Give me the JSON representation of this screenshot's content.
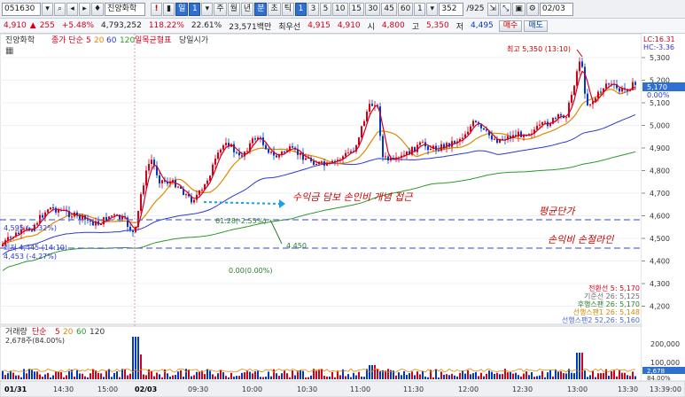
{
  "toolbar": {
    "code": "051630",
    "name": "진양화학",
    "btn_exclaim": "!",
    "btn_day": "일",
    "btn_day_num": "1",
    "periods": [
      "주",
      "월",
      "년",
      "분",
      "초",
      "틱"
    ],
    "minutes": [
      "1",
      "3",
      "5",
      "10",
      "15",
      "30",
      "45",
      "60",
      "1"
    ],
    "page": "352",
    "page_total": "/925",
    "date": "02/03"
  },
  "quote": {
    "price": "4,910",
    "change_arrow": "▲",
    "change": "255",
    "change_pct": "+5.48%",
    "volume": "4,793,252",
    "vol_ratio": "118.22%",
    "turnover": "22.61%",
    "amount": "23,571백만",
    "bid_label": "최우선",
    "bid1": "4,915",
    "bid2": "4,910",
    "open_label": "시",
    "open": "4,800",
    "high_label": "고",
    "high": "5,350",
    "low_label": "저",
    "low": "4,495",
    "buy_label": "매수",
    "sell_label": "매도"
  },
  "legend": {
    "name": "진양화학",
    "ma_label": "종가 단순",
    "ma_periods": [
      "5",
      "20",
      "60",
      "120"
    ],
    "ichimoku": "일목균형표",
    "daytime": "당일시가"
  },
  "annotations": {
    "high_marker": "최고 5,350 (13:10)",
    "strategy": "수익금 담보 손인비 개념 접근",
    "avg_cost": "평균단가",
    "stoploss": "손익비 손절라인",
    "avg_level": "61.28(-2.55%)",
    "stop_level": "4,450",
    "zero_level": "0.00(0.00%)",
    "left_label1": "4,595 (-1.32%)",
    "left_label2": "최저 4,445 (14:10)",
    "left_label3": "4,453 (-4.27%)",
    "lc": "LC:16.31",
    "hc": "HC:-3.36"
  },
  "ichimoku_labels": [
    {
      "text": "전환선 5: 5,170",
      "color": "#d4001a"
    },
    {
      "text": "기준선 26: 5,125",
      "color": "#6b6b6b"
    },
    {
      "text": "후행스팬 26: 5,170",
      "color": "#2a7d2a"
    },
    {
      "text": "선행스팬1 26: 5,148",
      "color": "#d48a00"
    },
    {
      "text": "선행스팬2 52,26: 5,160",
      "color": "#4a6ad0"
    }
  ],
  "price_axis": {
    "ticks": [
      "5,300",
      "5,200",
      "5,100",
      "5,000",
      "4,900",
      "4,800",
      "4,700",
      "4,600",
      "4,500",
      "4,400",
      "4,300",
      "4,200"
    ],
    "current_price": "5,170",
    "current_pct": "0.00%"
  },
  "volume": {
    "legend_name": "거래량",
    "ma_label": "단순",
    "ma_periods": [
      "5",
      "20",
      "60",
      "120"
    ],
    "left_label": "2,678주(84.00%)",
    "axis_ticks": [
      "200,000",
      "100,000"
    ],
    "current": "2,678",
    "current_pct": "84.00%"
  },
  "time_axis": {
    "labels": [
      "01/31",
      "14:30",
      "15:00",
      "02/03",
      "09:30",
      "10:00",
      "10:30",
      "11:00",
      "11:30",
      "12:00",
      "12:30",
      "13:00",
      "13:30"
    ],
    "cursor": "13:39:00"
  },
  "colors": {
    "up": "#d4001a",
    "down": "#0038c8",
    "ma5": "#d4001a",
    "ma20": "#e08a00",
    "ma60": "#2a3ad0",
    "ma120": "#2a9a2a",
    "dash": "#5a6ad8"
  }
}
